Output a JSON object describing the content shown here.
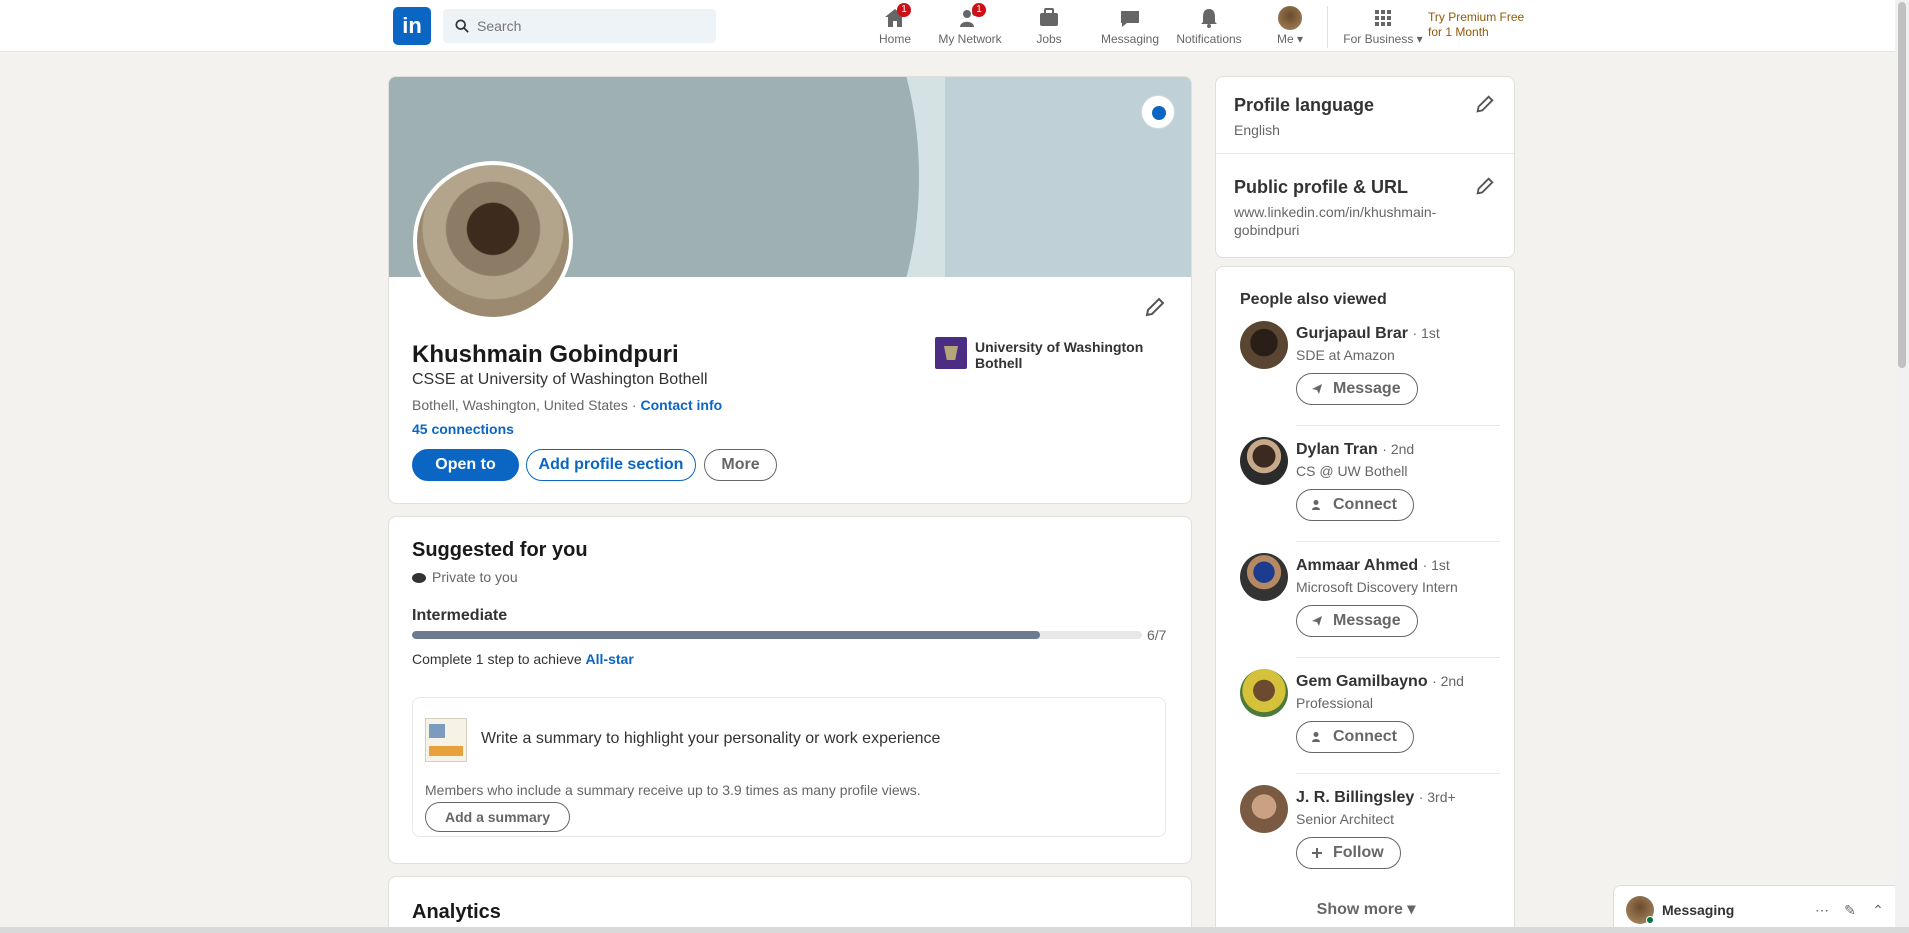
{
  "nav": {
    "logo": "in",
    "search_placeholder": "Search",
    "items": [
      {
        "label": "Home",
        "badge": "1"
      },
      {
        "label": "My Network",
        "badge": "1"
      },
      {
        "label": "Jobs",
        "badge": ""
      },
      {
        "label": "Messaging",
        "badge": ""
      },
      {
        "label": "Notifications",
        "badge": ""
      },
      {
        "label": "Me ▾",
        "badge": ""
      },
      {
        "label": "For Business ▾",
        "badge": ""
      }
    ],
    "premium_line1": "Try Premium Free",
    "premium_line2": "for 1 Month"
  },
  "profile": {
    "name": "Khushmain Gobindpuri",
    "headline": "CSSE at University of Washington Bothell",
    "location": "Bothell, Washington, United States",
    "separator": "·",
    "contact_info": "Contact info",
    "connections": "45 connections",
    "school": "University of Washington Bothell",
    "btn_open_to": "Open to",
    "btn_add_section": "Add profile section",
    "btn_more": "More"
  },
  "suggested": {
    "title": "Suggested for you",
    "subtitle": "Private to you",
    "level": "Intermediate",
    "progress": 0.86,
    "progress_count": "6/7",
    "complete_text": "Complete 1 step to achieve",
    "star_link": "All-star",
    "tip_title": "Write a summary to highlight your personality or work experience",
    "tip_desc": "Members who include a summary receive up to 3.9 times as many profile views.",
    "tip_button": "Add a summary"
  },
  "analytics": {
    "title": "Analytics"
  },
  "settings": {
    "language_title": "Profile language",
    "language_value": "English",
    "url_title": "Public profile & URL",
    "url_value": "www.linkedin.com/in/khushmain-gobindpuri"
  },
  "people_also_viewed": {
    "title": "People also viewed",
    "items": [
      {
        "name": "Gurjapaul Brar",
        "degree": "· 1st",
        "headline": "SDE at Amazon",
        "action": "Message"
      },
      {
        "name": "Dylan Tran",
        "degree": "· 2nd",
        "headline": "CS @ UW Bothell",
        "action": "Connect"
      },
      {
        "name": "Ammaar Ahmed",
        "degree": "· 1st",
        "headline": "Microsoft Discovery Intern",
        "action": "Message"
      },
      {
        "name": "Gem Gamilbayno",
        "degree": "· 2nd",
        "headline": "Professional",
        "action": "Connect"
      },
      {
        "name": "J. R. Billingsley",
        "degree": "· 3rd+",
        "headline": "Senior Architect",
        "action": "Follow"
      }
    ],
    "show_more": "Show more ▾"
  },
  "messaging": {
    "label": "Messaging",
    "ctrl1": "⋯",
    "ctrl2": "✎",
    "ctrl3": "⌃"
  }
}
